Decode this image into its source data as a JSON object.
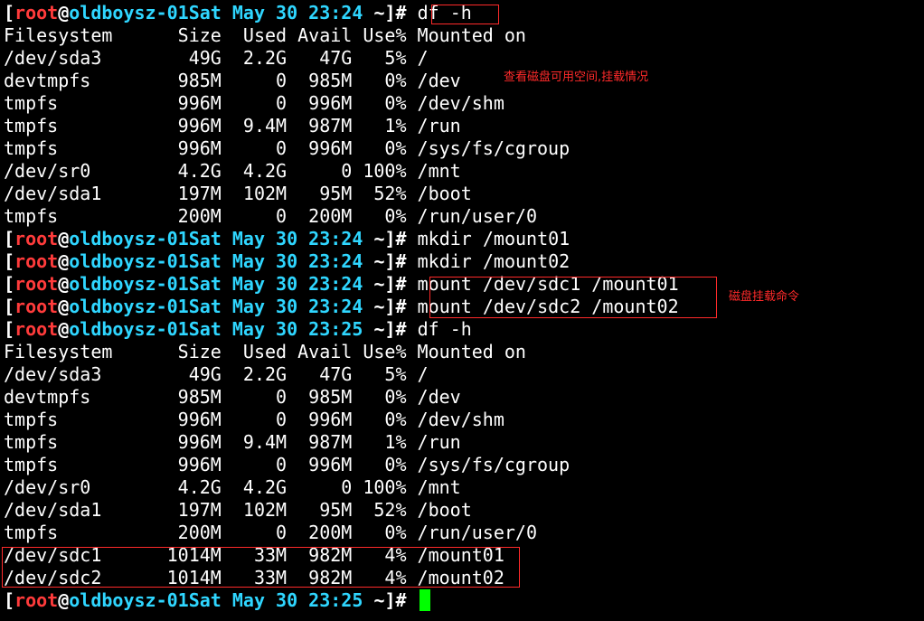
{
  "prompt": {
    "open": "[",
    "user": "root",
    "at": "@",
    "host": "oldboysz-01",
    "date_prefix": "Sat May 30 ",
    "dir": "~",
    "close": "]#"
  },
  "session": [
    {
      "kind": "cmd",
      "time": "23:24",
      "command": " df -h"
    },
    {
      "kind": "out",
      "text": "Filesystem      Size  Used Avail Use% Mounted on"
    },
    {
      "kind": "out",
      "text": "/dev/sda3        49G  2.2G   47G   5% /"
    },
    {
      "kind": "out",
      "text": "devtmpfs        985M     0  985M   0% /dev"
    },
    {
      "kind": "out",
      "text": "tmpfs           996M     0  996M   0% /dev/shm"
    },
    {
      "kind": "out",
      "text": "tmpfs           996M  9.4M  987M   1% /run"
    },
    {
      "kind": "out",
      "text": "tmpfs           996M     0  996M   0% /sys/fs/cgroup"
    },
    {
      "kind": "out",
      "text": "/dev/sr0        4.2G  4.2G     0 100% /mnt"
    },
    {
      "kind": "out",
      "text": "/dev/sda1       197M  102M   95M  52% /boot"
    },
    {
      "kind": "out",
      "text": "tmpfs           200M     0  200M   0% /run/user/0"
    },
    {
      "kind": "cmd",
      "time": "23:24",
      "command": " mkdir /mount01"
    },
    {
      "kind": "cmd",
      "time": "23:24",
      "command": " mkdir /mount02"
    },
    {
      "kind": "cmd",
      "time": "23:24",
      "command": " mount /dev/sdc1 /mount01"
    },
    {
      "kind": "cmd",
      "time": "23:24",
      "command": " mount /dev/sdc2 /mount02"
    },
    {
      "kind": "cmd",
      "time": "23:25",
      "command": " df -h"
    },
    {
      "kind": "out",
      "text": "Filesystem      Size  Used Avail Use% Mounted on"
    },
    {
      "kind": "out",
      "text": "/dev/sda3        49G  2.2G   47G   5% /"
    },
    {
      "kind": "out",
      "text": "devtmpfs        985M     0  985M   0% /dev"
    },
    {
      "kind": "out",
      "text": "tmpfs           996M     0  996M   0% /dev/shm"
    },
    {
      "kind": "out",
      "text": "tmpfs           996M  9.4M  987M   1% /run"
    },
    {
      "kind": "out",
      "text": "tmpfs           996M     0  996M   0% /sys/fs/cgroup"
    },
    {
      "kind": "out",
      "text": "/dev/sr0        4.2G  4.2G     0 100% /mnt"
    },
    {
      "kind": "out",
      "text": "/dev/sda1       197M  102M   95M  52% /boot"
    },
    {
      "kind": "out",
      "text": "tmpfs           200M     0  200M   0% /run/user/0"
    },
    {
      "kind": "out",
      "text": "/dev/sdc1      1014M   33M  982M   4% /mount01"
    },
    {
      "kind": "out",
      "text": "/dev/sdc2      1014M   33M  982M   4% /mount02"
    },
    {
      "kind": "cmd",
      "time": "23:25",
      "command": " ",
      "cursor": true
    }
  ],
  "annotations": {
    "note_df": "查看磁盘可用空间,挂载情况",
    "note_mount": "磁盘挂载命令"
  },
  "colors": {
    "background": "#000000",
    "text": "#ffffff",
    "user": "#ff3b3b",
    "host": "#2fd6ff",
    "cursor": "#00ff00",
    "highlight_box": "#ff2a2a"
  }
}
